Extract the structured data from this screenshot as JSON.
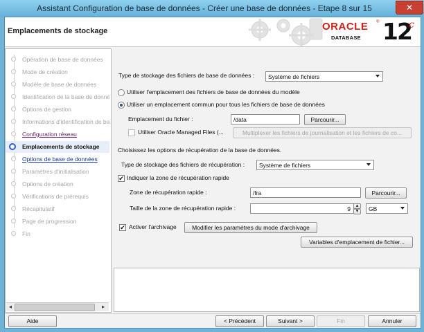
{
  "window": {
    "title": "Assistant Configuration de base de données - Créer une base de données - Etape 8 sur 15",
    "close_glyph": "✕"
  },
  "header": {
    "title": "Emplacements de stockage",
    "logo": {
      "oracle": "ORACLE",
      "registered": "®",
      "database": "DATABASE",
      "version": "12",
      "version_suffix": "c"
    }
  },
  "sidebar": {
    "steps": [
      {
        "label": "Opération de base de données",
        "state": "disabled"
      },
      {
        "label": "Mode de création",
        "state": "disabled"
      },
      {
        "label": "Modèle de base de données",
        "state": "disabled"
      },
      {
        "label": "Identification de la base de données",
        "state": "disabled"
      },
      {
        "label": "Options de gestion",
        "state": "disabled"
      },
      {
        "label": "Informations d'identification de base",
        "state": "disabled"
      },
      {
        "label": "Configuration réseau",
        "state": "visited"
      },
      {
        "label": "Emplacements de stockage",
        "state": "current"
      },
      {
        "label": "Options de base de données",
        "state": "link"
      },
      {
        "label": "Paramètres d'initialisation",
        "state": "disabled"
      },
      {
        "label": "Options de création",
        "state": "disabled"
      },
      {
        "label": "Vérifications de prérequis",
        "state": "disabled"
      },
      {
        "label": "Récapitulatif",
        "state": "disabled"
      },
      {
        "label": "Page de progression",
        "state": "disabled"
      },
      {
        "label": "Fin",
        "state": "disabled"
      }
    ],
    "scroll_left": "◂",
    "scroll_right": "▸"
  },
  "db_files": {
    "storage_type_label": "Type de stockage des fichiers de base de données :",
    "storage_type_value": "Système de fichiers",
    "radio_template_label": "Utiliser l'emplacement des fichiers de base de données du modèle",
    "radio_common_label": "Utiliser un emplacement commun pour tous les fichiers de base de données",
    "file_location_label": "Emplacement du fichier :",
    "file_location_value": "/data",
    "browse_label": "Parcourir...",
    "omf_label": "Utiliser Oracle Managed Files (...",
    "multiplex_label": "Multiplexer les fichiers de journalisation et les fichiers de co..."
  },
  "recovery": {
    "section_label": "Choisissez les options de récupération de la base de données.",
    "storage_type_label": "Type de stockage des fichiers de récupération :",
    "storage_type_value": "Système de fichiers",
    "fra_check_label": "Indiquer la zone de récupération rapide",
    "fra_check_mark": "✔",
    "fra_zone_label": "Zone de récupération rapide :",
    "fra_zone_value": "/fra",
    "browse_label": "Parcourir...",
    "fra_size_label": "Taille de la zone de récupération rapide :",
    "fra_size_value": "9",
    "fra_size_unit": "GB",
    "spin_up": "▴",
    "spin_down": "▾",
    "archive_check_label": "Activer l'archivage",
    "archive_check_mark": "✔",
    "archive_params_label": "Modifier les paramètres du mode d'archivage",
    "file_location_vars_label": "Variables d'emplacement de fichier..."
  },
  "footer": {
    "help": "Aide",
    "back": "< Précédent",
    "next": "Suivant >",
    "finish": "Fin",
    "cancel": "Annuler"
  }
}
